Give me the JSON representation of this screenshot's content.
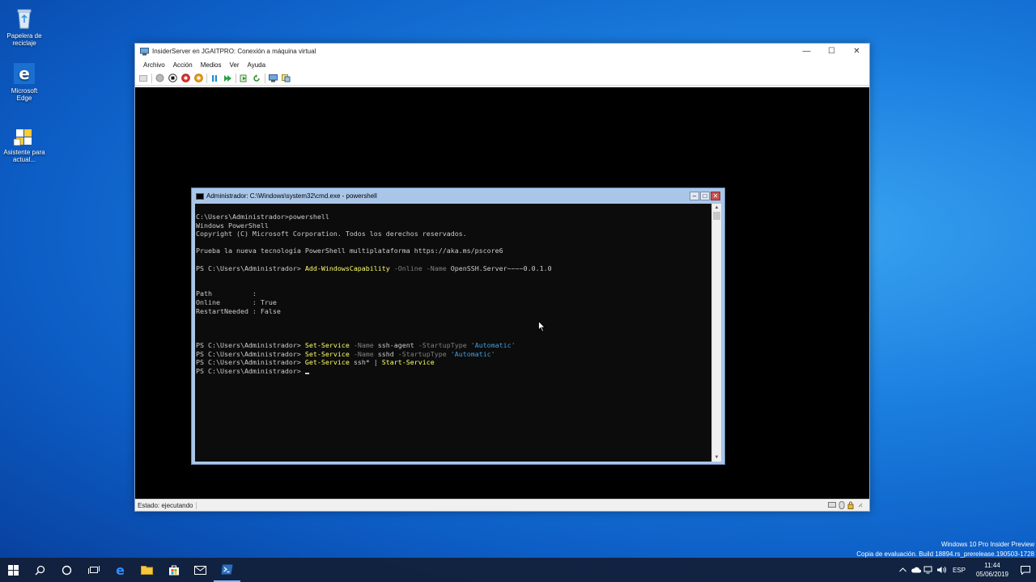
{
  "desktop": {
    "icons": [
      {
        "label": "Papelera de reciclaje"
      },
      {
        "label": "Microsoft Edge"
      },
      {
        "label": "Asistente para actual..."
      }
    ]
  },
  "vm_window": {
    "title": "InsiderServer en JGAITPRO: Conexión a máquina virtual",
    "menu": [
      "Archivo",
      "Acción",
      "Medios",
      "Ver",
      "Ayuda"
    ],
    "status": "Estado: ejecutando"
  },
  "console": {
    "title": "Administrador: C:\\Windows\\system32\\cmd.exe - powershell",
    "lines": {
      "l1": "C:\\Users\\Administrador>powershell",
      "l2": "Windows PowerShell",
      "l3": "Copyright (C) Microsoft Corporation. Todos los derechos reservados.",
      "l4": "Prueba la nueva tecnología PowerShell multiplataforma https://aka.ms/pscore6",
      "prompt": "PS C:\\Users\\Administrador> ",
      "cmd1": "Add-WindowsCapability",
      "cmd1_p1": " -Online",
      "cmd1_p2": " -Name",
      "cmd1_v": " OpenSSH.Server~~~~0.0.1.0",
      "path_line": "Path          :",
      "online_line": "Online        : True",
      "restart_line": "RestartNeeded : False",
      "cmd2": "Set-Service",
      "cmd2_p1": " -Name",
      "cmd2_v1": " ssh-agent",
      "cmd2_p2": " -StartupType",
      "cmd2_s": " 'Automatic'",
      "cmd3": "Set-Service",
      "cmd3_p1": " -Name",
      "cmd3_v1": " sshd",
      "cmd3_p2": " -StartupType",
      "cmd3_s": " 'Automatic'",
      "cmd4": "Get-Service",
      "cmd4_v": " ssh* | ",
      "cmd4_b": "Start-Service"
    }
  },
  "watermark": {
    "line1": "Windows 10 Pro Insider Preview",
    "line2": "Copia de evaluación. Build 18894.rs_prerelease.190503-1728"
  },
  "taskbar": {
    "lang": "ESP",
    "time": "11:44",
    "date": "05/06/2019"
  }
}
